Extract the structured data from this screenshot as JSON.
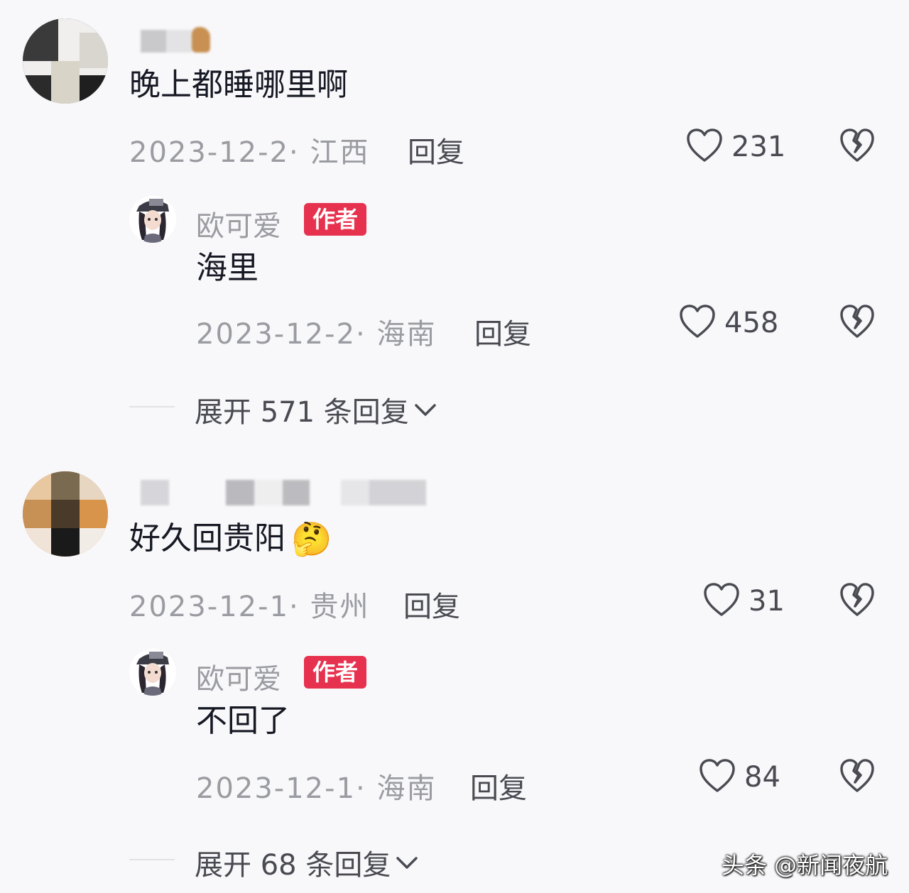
{
  "comments": [
    {
      "text": "晚上都睡哪里啊",
      "date_region": "2023-12-2· 江西",
      "reply_label": "回复",
      "likes": "231",
      "author_reply": {
        "name": "欧可爱",
        "badge": "作者",
        "text": "海里",
        "date_region": "2023-12-2· 海南",
        "reply_label": "回复",
        "likes": "458"
      },
      "expand_label": "展开 571 条回复"
    },
    {
      "text": "好久回贵阳",
      "emoji": "🤔",
      "date_region": "2023-12-1· 贵州",
      "reply_label": "回复",
      "likes": "31",
      "author_reply": {
        "name": "欧可爱",
        "badge": "作者",
        "text": "不回了",
        "date_region": "2023-12-1· 海南",
        "reply_label": "回复",
        "likes": "84"
      },
      "expand_label": "展开 68 条回复"
    }
  ],
  "watermark": "头条 @新闻夜航",
  "icons": {
    "like": "heart-outline-icon",
    "dislike": "broken-heart-icon",
    "expand": "chevron-down-icon"
  }
}
